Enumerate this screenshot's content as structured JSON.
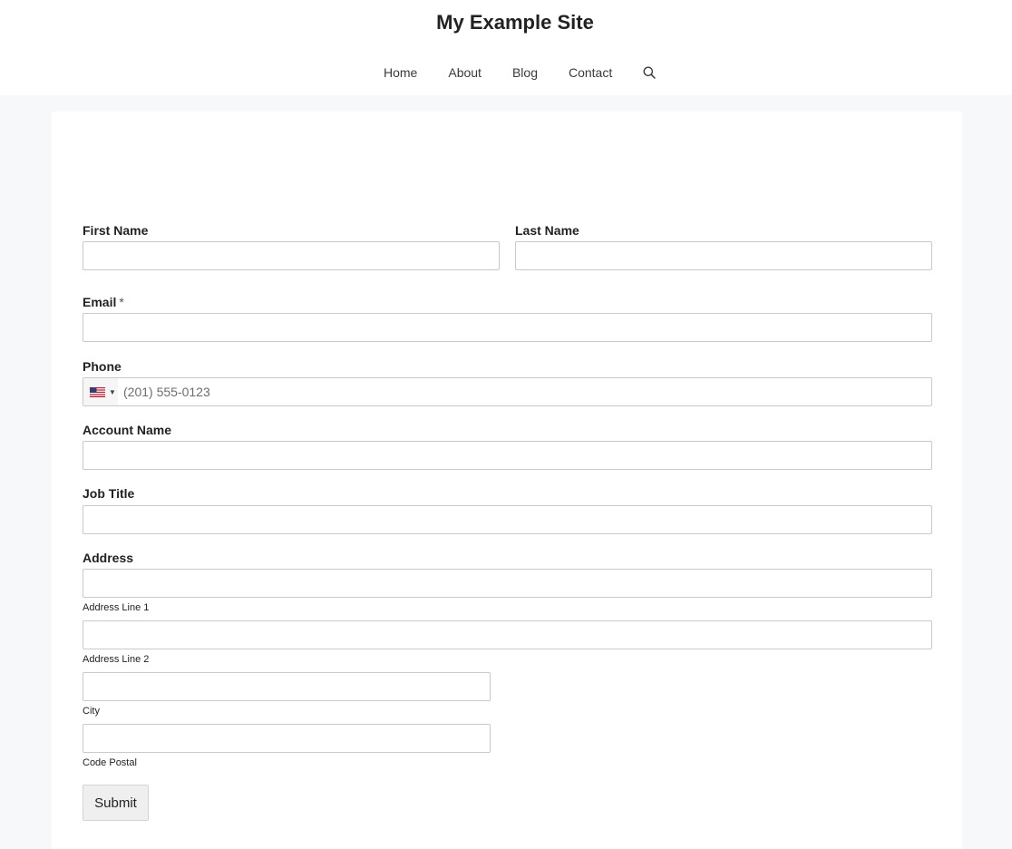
{
  "site": {
    "title": "My Example Site"
  },
  "nav": {
    "items": [
      {
        "label": "Home"
      },
      {
        "label": "About"
      },
      {
        "label": "Blog"
      },
      {
        "label": "Contact"
      }
    ],
    "search_icon": "search-icon"
  },
  "form": {
    "first_name": {
      "label": "First Name",
      "value": ""
    },
    "last_name": {
      "label": "Last Name",
      "value": ""
    },
    "email": {
      "label": "Email",
      "required_mark": "*",
      "value": ""
    },
    "phone": {
      "label": "Phone",
      "placeholder": "(201) 555-0123",
      "country_flag": "us-flag-icon",
      "value": ""
    },
    "account_name": {
      "label": "Account Name",
      "value": ""
    },
    "job_title": {
      "label": "Job Title",
      "value": ""
    },
    "address": {
      "label": "Address",
      "line1_sublabel": "Address Line 1",
      "line2_sublabel": "Address Line 2",
      "city_sublabel": "City",
      "postal_sublabel": "Code Postal"
    },
    "submit_label": "Submit"
  },
  "colors": {
    "page_background": "#f7f8f9",
    "card_background": "#ffffff",
    "input_border": "#c9c9c9",
    "button_background": "#efefef"
  }
}
